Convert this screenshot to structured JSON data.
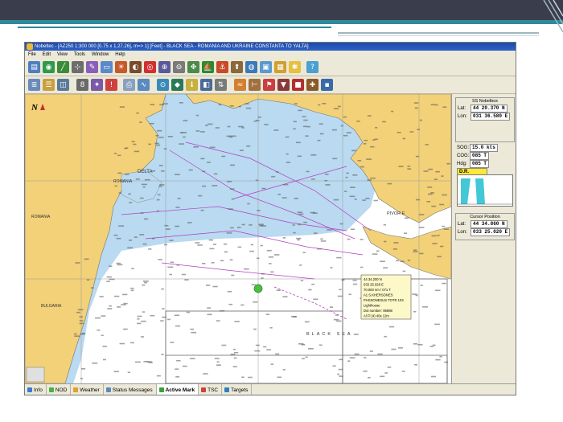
{
  "window": {
    "title": "Nobeltec - [AZ250 1:300 000 [0.75 x 1.27.26], m=> 1] [Feet] - BLACK SEA - ROMANIA AND UKRAINE CONSTANTA TO YALTA]",
    "menu": [
      "File",
      "Edit",
      "View",
      "Tools",
      "Window",
      "Help"
    ]
  },
  "chart": {
    "north_label": "N",
    "place_labels": [
      "DELTA",
      "ROMANIA",
      "ROMANIA",
      "BULGARIA",
      "PIVOR E",
      "BLACK SEA"
    ],
    "callout_lines": [
      "44 34.200 N",
      "033 25.028 E",
      "70.000 nm / 071 T",
      "A1 S.KHERSONES",
      "PHSSONESUS TOTR 103",
      "Lighthouse",
      "Dot number: 95898",
      "Al Fl (4) 40s 12m"
    ]
  },
  "nobelbox": {
    "title": "SS Nobelbox",
    "lat_label": "Lat:",
    "lat": "44 20.370 N",
    "lon_label": "Lon:",
    "lon": "031 36.580 E",
    "sog_label": "SOG:",
    "sog": "15.0 kts",
    "cog_label": "COG:",
    "cog": "085 T",
    "hdg_label": "Hdg:",
    "hdg": "085 T",
    "dr": "D.R."
  },
  "cursor": {
    "title": "Cursor Position",
    "lat_label": "Lat:",
    "lat": "44 34.860 N",
    "lon_label": "Lon:",
    "lon": "033 25.020 E"
  },
  "tabs": [
    "Info",
    "NOD",
    "Weather",
    "Status Messages",
    "Active Mark",
    "TSC",
    "Targets"
  ],
  "colors": {
    "land": "#f2d178",
    "shallow_water": "#b9daf0",
    "deep_water": "#ffffff",
    "route": "#b43cc4",
    "dr_highlight": "#ffe833",
    "slide_banner": "#3a3d4c",
    "slide_accent": "#2f8a99"
  }
}
